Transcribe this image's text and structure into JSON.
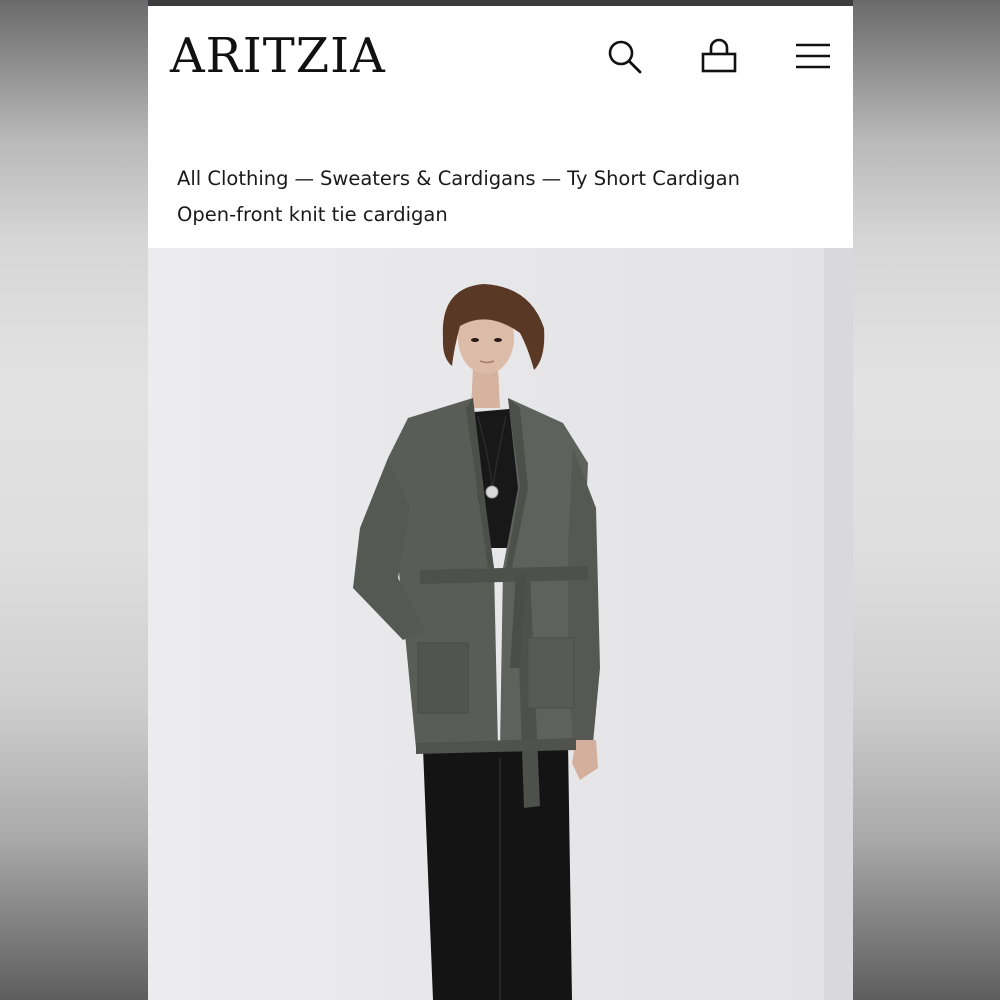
{
  "header": {
    "logo": "ARITZIA",
    "icons": [
      "search-icon",
      "shopping-bag-icon",
      "menu-icon"
    ]
  },
  "breadcrumb": {
    "items": [
      "All Clothing",
      "Sweaters & Cardigans",
      "Ty Short Cardigan"
    ],
    "separator": "—"
  },
  "product": {
    "subtitle": "Open-front knit tie cardigan"
  },
  "colors": {
    "text": "#1a1a1a",
    "background": "#ffffff",
    "cardigan": "#5a5d58",
    "trousers": "#141414"
  }
}
